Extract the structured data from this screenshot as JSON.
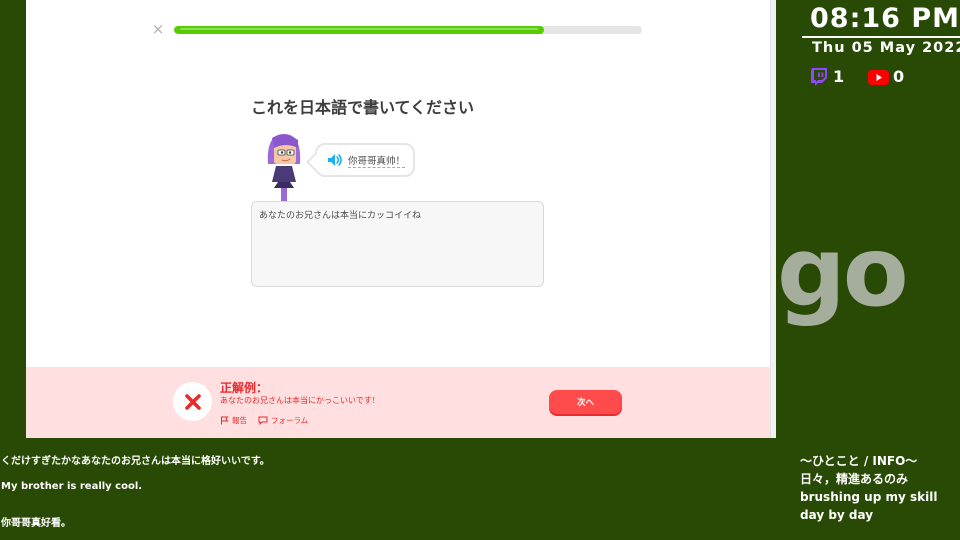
{
  "lesson": {
    "close_icon": "×",
    "progress_percent": 79,
    "prompt": "これを日本語で書いてください",
    "bubble": {
      "speaker_icon": "speaker-icon",
      "text": "你哥哥真帅！"
    },
    "answer_text": "あなたのお兄さんは本当にカッコイイね",
    "feedback": {
      "title": "正解例：",
      "solution": "あなたのお兄さんは本当にかっこいいです！",
      "report_label": "報告",
      "forum_label": "フォーラム",
      "next_label": "次へ"
    },
    "colors": {
      "accent_green": "#58cc02",
      "error_red": "#ea2b2b",
      "feedback_bg": "#ffdfe0",
      "button_red": "#ff4b4b"
    }
  },
  "watermark": "go",
  "overlay": {
    "time": "08:16 PM",
    "date": "Thu 05 May 2022",
    "twitch_count": "1",
    "youtube_count": "0",
    "info_title": "〜ひとこと / INFO〜",
    "info_line1": "日々，精進あるのみ",
    "info_line2": "brushing up my skill day by day",
    "colors": {
      "background": "#284a05",
      "twitch": "#9146ff",
      "youtube": "#ff0000"
    }
  },
  "subtitles": {
    "japanese": "くだけすぎたかなあなたのお兄さんは本当に格好いいです。",
    "english": "My brother is really cool.",
    "chinese": "你哥哥真好看。"
  }
}
